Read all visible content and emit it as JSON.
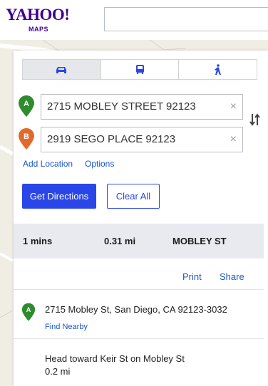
{
  "header": {
    "logo_text": "YAHOO!",
    "logo_sub": "MAPS",
    "search_value": ""
  },
  "modes": [
    {
      "name": "drive",
      "icon": "car-icon",
      "active": true
    },
    {
      "name": "transit",
      "icon": "bus-icon",
      "active": false
    },
    {
      "name": "walk",
      "icon": "walking-icon",
      "active": false
    }
  ],
  "route": {
    "start": {
      "pin_label": "A",
      "value": "2715 MOBLEY STREET 92123",
      "pin_color": "#2e8b2e"
    },
    "end": {
      "pin_label": "B",
      "value": "2919 SEGO PLACE 92123",
      "pin_color": "#e06a2b"
    },
    "clear_glyph": "×"
  },
  "links": {
    "add_location": "Add Location",
    "options": "Options"
  },
  "buttons": {
    "get_directions": "Get Directions",
    "clear_all": "Clear All"
  },
  "summary": {
    "time": "1 mins",
    "distance": "0.31 mi",
    "street": "MOBLEY ST"
  },
  "actions": {
    "print": "Print",
    "share": "Share"
  },
  "steps": {
    "start_address": "2715 Mobley St, San Diego, CA 92123-3032",
    "find_nearby": "Find Nearby",
    "first_instruction": "Head toward Keir St on Mobley St",
    "first_distance": "0.2 mi"
  },
  "colors": {
    "brand": "#400090",
    "accent": "#2a46e8",
    "link": "#1b56c9"
  }
}
